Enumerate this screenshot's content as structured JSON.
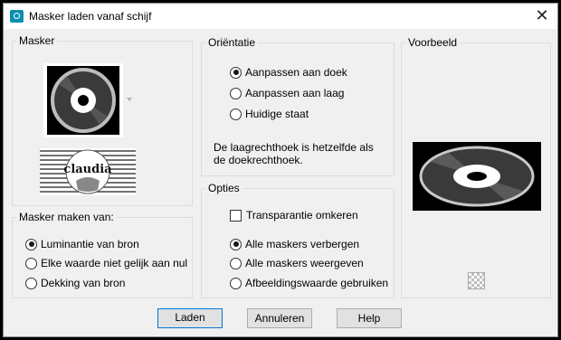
{
  "window": {
    "title": "Masker laden vanaf schijf",
    "close_glyph": "✕"
  },
  "masker": {
    "label": "Masker",
    "thumbnail_icon": "disc-mask-thumbnail",
    "dropdown_icon": "dropdown-arrow-icon",
    "watermark_text": "claudia"
  },
  "mask_source": {
    "label": "Masker maken van:",
    "options": [
      "Luminantie van bron",
      "Elke waarde niet gelijk aan nul",
      "Dekking van bron"
    ],
    "selected": 0
  },
  "orientation": {
    "label": "Oriëntatie",
    "options": [
      "Aanpassen aan doek",
      "Aanpassen aan laag",
      "Huidige staat"
    ],
    "selected": 0,
    "note_line1": "De laagrechthoek is hetzelfde als",
    "note_line2": "de doekrechthoek."
  },
  "options": {
    "label": "Opties",
    "invert_label": "Transparantie omkeren",
    "invert_checked": false,
    "visibility_options": [
      "Alle maskers verbergen",
      "Alle maskers weergeven",
      "Afbeeldingswaarde gebruiken"
    ],
    "visibility_selected": 0
  },
  "preview": {
    "label": "Voorbeeld",
    "transparency_icon": "checkerboard-icon"
  },
  "buttons": {
    "load": "Laden",
    "cancel": "Annuleren",
    "help": "Help"
  }
}
